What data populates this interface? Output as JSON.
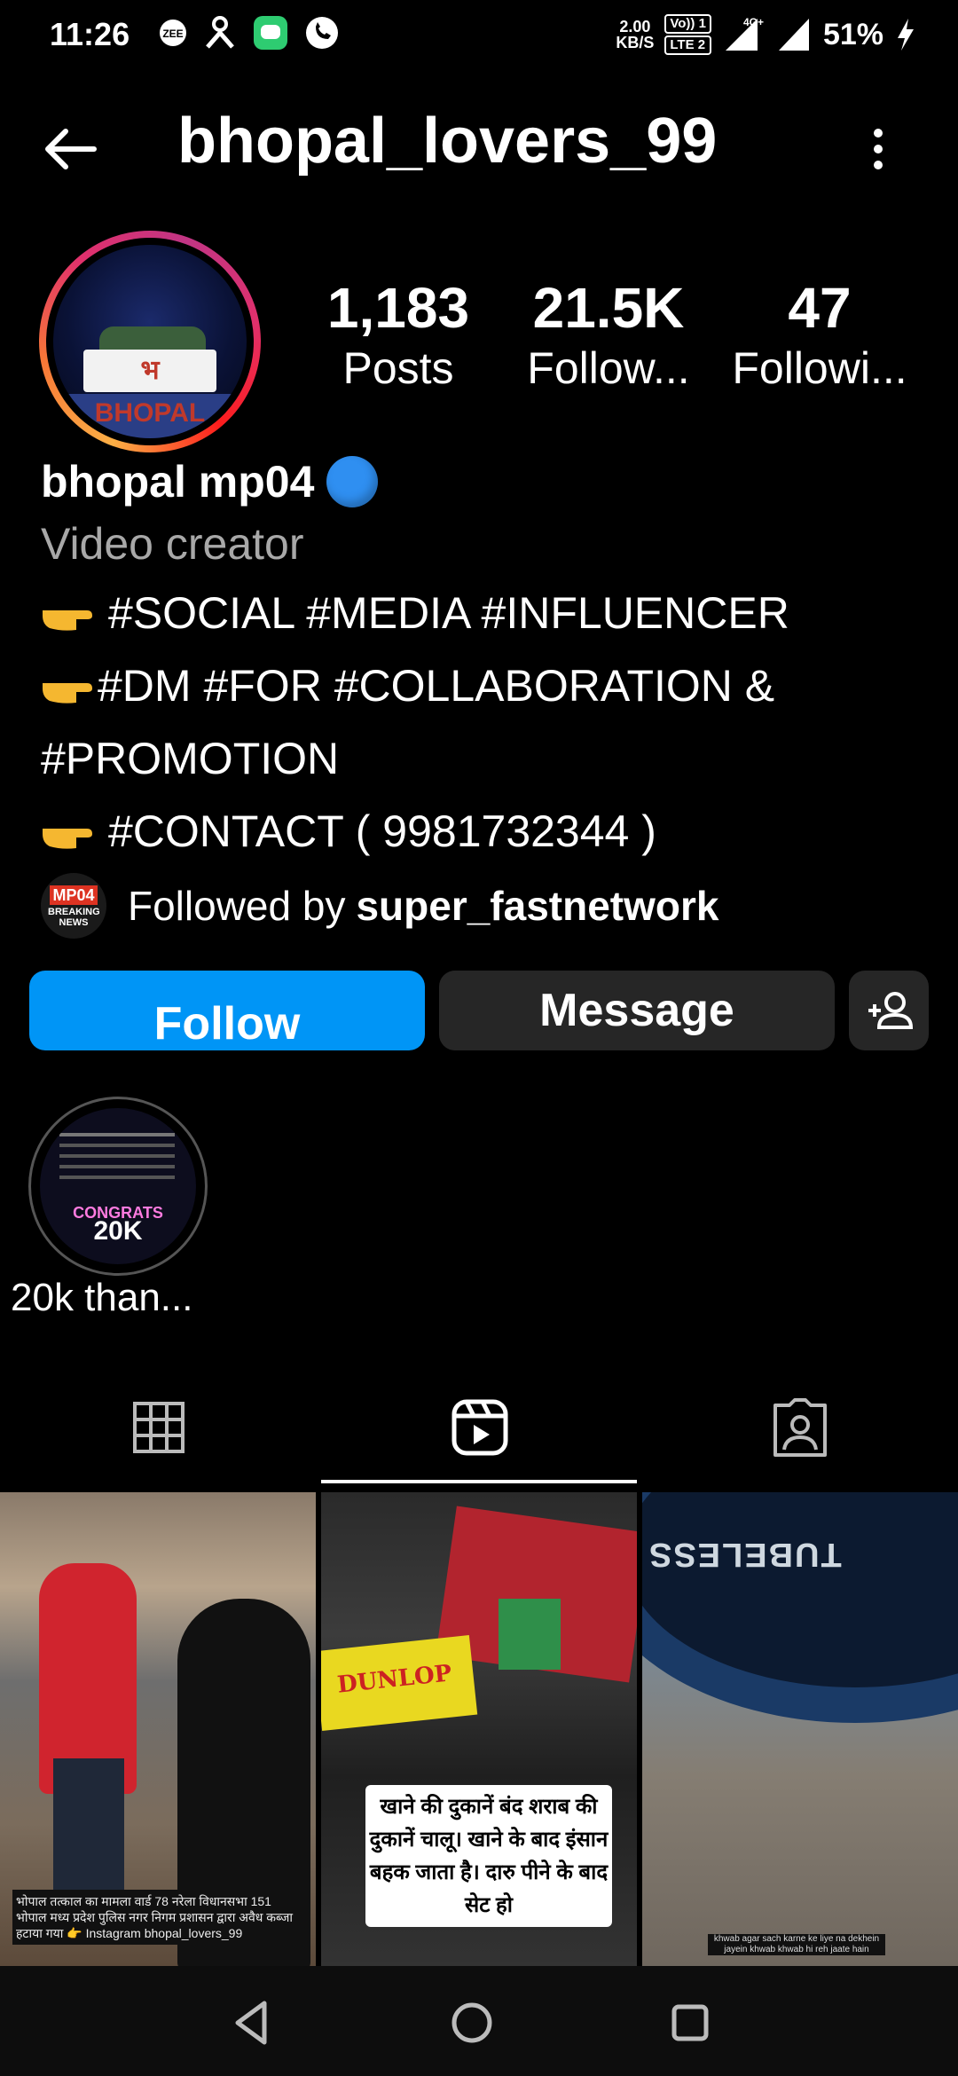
{
  "status_bar": {
    "time": "11:26",
    "speed_value": "2.00",
    "speed_unit": "KB/S",
    "volte_top": "Vo)) 1",
    "volte_bottom": "LTE 2",
    "network": "4G+",
    "battery": "51%"
  },
  "header": {
    "title": "bhopal_lovers_99"
  },
  "profile": {
    "avatar_sign": "भ BHOPAL",
    "stats": [
      {
        "value": "1,183",
        "label": "Posts"
      },
      {
        "value": "21.5K",
        "label": "Follow..."
      },
      {
        "value": "47",
        "label": "Followi..."
      }
    ],
    "name": "bhopal mp04",
    "category": "Video creator",
    "bio": [
      "#SOCIAL  #MEDIA  #INFLUENCER",
      "#DM #FOR #COLLABORATION &",
      "#PROMOTION",
      "#CONTACT ( 9981732344 )"
    ],
    "followed_prefix": "Followed by",
    "followed_user": "super_fastnetwork",
    "follower_avatar": {
      "top": "MP04",
      "bottom": "BREAKING NEWS"
    }
  },
  "actions": {
    "follow_label": "Follow",
    "message_label": "Message"
  },
  "highlights": [
    {
      "label": "20k than...",
      "cover_text": "CONGRATS",
      "cover_number": "20K"
    }
  ],
  "grid": [
    {
      "caption": "भोपाल तत्काल का मामला वार्ड 78 नरेला विधानसभा 151 भोपाल मध्य प्रदेश पुलिस नगर निगम प्रशासन द्वारा अवैध कब्जा हटाया गया  👉 Instagram bhopal_lovers_99"
    },
    {
      "caption": "खाने की दुकानें बंद शराब की दुकानें चालू। खाने के बाद इंसान बहक जाता है। दारु पीने के बाद सेट हो",
      "sign": "DUNLOP"
    },
    {
      "caption": "khwab agar sach karne ke liye na dekhein jayein khwab khwab hi reh jaate hain",
      "sign": "TUBELESS"
    }
  ],
  "colors": {
    "background": "#000000",
    "accent_blue": "#0095f6",
    "button_gray": "#262626",
    "secondary_text": "#a8a8a8"
  },
  "icons": {
    "back": "arrow-left-icon",
    "more": "more-vertical-icon",
    "add_person": "add-person-icon",
    "tab_grid": "grid-icon",
    "tab_reels": "reels-icon",
    "tab_tagged": "tagged-icon"
  }
}
